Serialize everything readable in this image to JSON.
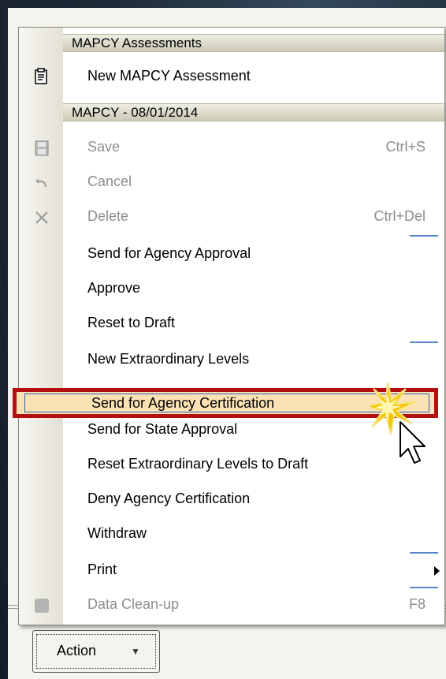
{
  "menu": {
    "section1_header": "MAPCY Assessments",
    "new_assessment": "New MAPCY Assessment",
    "section2_header": "MAPCY - 08/01/2014",
    "items": [
      {
        "label": "Save",
        "shortcut": "Ctrl+S",
        "enabled": false,
        "icon": "save-icon"
      },
      {
        "label": "Cancel",
        "shortcut": "",
        "enabled": false,
        "icon": "undo-icon"
      },
      {
        "label": "Delete",
        "shortcut": "Ctrl+Del",
        "enabled": false,
        "icon": "delete-x-icon"
      },
      {
        "label": "Send for Agency Approval",
        "shortcut": "",
        "enabled": true
      },
      {
        "label": "Approve",
        "shortcut": "",
        "enabled": true
      },
      {
        "label": "Reset to Draft",
        "shortcut": "",
        "enabled": true
      },
      {
        "label": "New Extraordinary Levels",
        "shortcut": "",
        "enabled": true
      },
      {
        "label": "Send for Agency Certification",
        "shortcut": "",
        "enabled": true,
        "highlighted": true
      },
      {
        "label": "Send for State Approval",
        "shortcut": "",
        "enabled": true
      },
      {
        "label": "Reset Extraordinary Levels to Draft",
        "shortcut": "",
        "enabled": true
      },
      {
        "label": "Deny Agency Certification",
        "shortcut": "",
        "enabled": true
      },
      {
        "label": "Withdraw",
        "shortcut": "",
        "enabled": true
      },
      {
        "label": "Print",
        "shortcut": "",
        "enabled": true,
        "submenu": true
      },
      {
        "label": "Data Clean-up",
        "shortcut": "F8",
        "enabled": false
      }
    ]
  },
  "action_button": {
    "label": "Action",
    "arrow": "▼"
  },
  "colors": {
    "highlight_border": "#b30f10",
    "highlight_fill": "#fbe2b4",
    "frame": "#1e2b38"
  }
}
